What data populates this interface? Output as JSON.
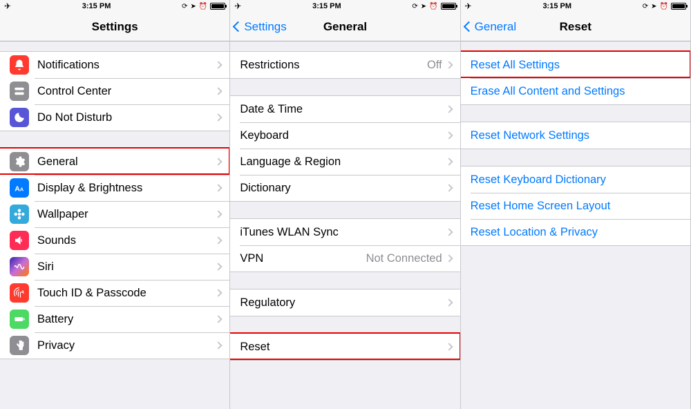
{
  "status": {
    "time": "3:15 PM"
  },
  "pane1": {
    "title": "Settings",
    "group1": [
      {
        "name": "notifications",
        "label": "Notifications",
        "icon": "bell-icon",
        "bg": "bg-red"
      },
      {
        "name": "control-center",
        "label": "Control Center",
        "icon": "switches-icon",
        "bg": "bg-gray"
      },
      {
        "name": "dnd",
        "label": "Do Not Disturb",
        "icon": "moon-icon",
        "bg": "bg-indigo"
      }
    ],
    "group2": [
      {
        "name": "general",
        "label": "General",
        "icon": "gear-icon",
        "bg": "bg-gray"
      },
      {
        "name": "display",
        "label": "Display & Brightness",
        "icon": "text-size-icon",
        "bg": "bg-blue"
      },
      {
        "name": "wallpaper",
        "label": "Wallpaper",
        "icon": "flower-icon",
        "bg": "bg-cyan"
      },
      {
        "name": "sounds",
        "label": "Sounds",
        "icon": "speaker-icon",
        "bg": "bg-pink"
      },
      {
        "name": "siri",
        "label": "Siri",
        "icon": "siri-icon",
        "bg": "bg-siri"
      },
      {
        "name": "touchid",
        "label": "Touch ID & Passcode",
        "icon": "fingerprint-icon",
        "bg": "bg-finger"
      },
      {
        "name": "battery",
        "label": "Battery",
        "icon": "battery-icon",
        "bg": "bg-green"
      },
      {
        "name": "privacy",
        "label": "Privacy",
        "icon": "hand-icon",
        "bg": "bg-hand"
      }
    ]
  },
  "pane2": {
    "title": "General",
    "back": "Settings",
    "g1": [
      {
        "name": "restrictions",
        "label": "Restrictions",
        "value": "Off"
      }
    ],
    "g2": [
      {
        "name": "date-time",
        "label": "Date & Time"
      },
      {
        "name": "keyboard",
        "label": "Keyboard"
      },
      {
        "name": "language",
        "label": "Language & Region"
      },
      {
        "name": "dictionary",
        "label": "Dictionary"
      }
    ],
    "g3": [
      {
        "name": "itunes-sync",
        "label": "iTunes WLAN Sync"
      },
      {
        "name": "vpn",
        "label": "VPN",
        "value": "Not Connected"
      }
    ],
    "g4": [
      {
        "name": "regulatory",
        "label": "Regulatory"
      }
    ],
    "g5": [
      {
        "name": "reset",
        "label": "Reset"
      }
    ]
  },
  "pane3": {
    "title": "Reset",
    "back": "General",
    "g1": [
      {
        "name": "reset-all",
        "label": "Reset All Settings"
      },
      {
        "name": "erase-all",
        "label": "Erase All Content and Settings"
      }
    ],
    "g2": [
      {
        "name": "reset-network",
        "label": "Reset Network Settings"
      }
    ],
    "g3": [
      {
        "name": "reset-keyboard",
        "label": "Reset Keyboard Dictionary"
      },
      {
        "name": "reset-home",
        "label": "Reset Home Screen Layout"
      },
      {
        "name": "reset-location",
        "label": "Reset Location & Privacy"
      }
    ]
  }
}
